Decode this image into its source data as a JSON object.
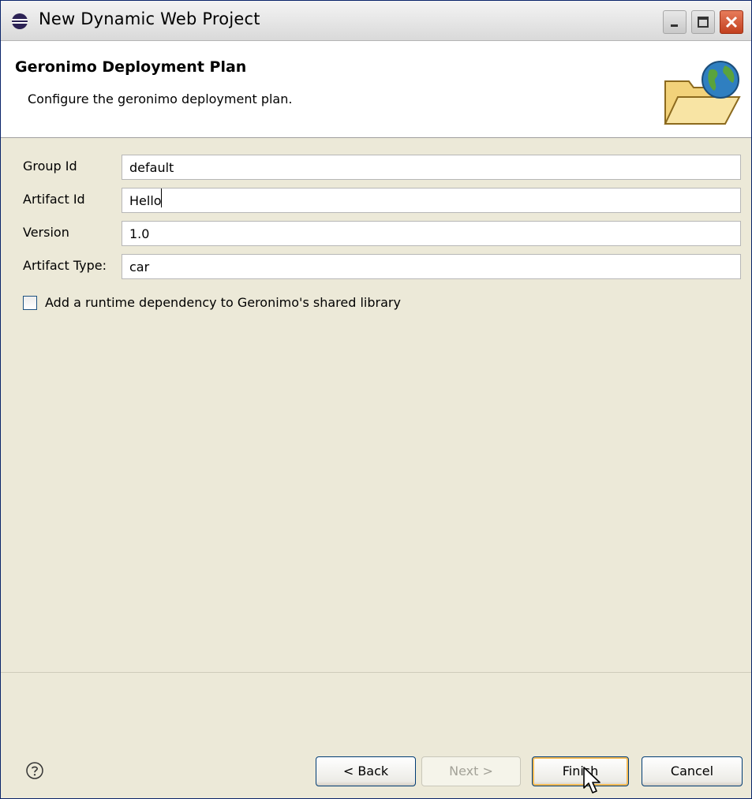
{
  "window": {
    "title": "New Dynamic Web Project",
    "icon": "eclipse-icon",
    "controls": [
      "minimize-icon",
      "maximize-icon",
      "close-icon"
    ]
  },
  "header": {
    "title": "Geronimo Deployment Plan",
    "description": "Configure the geronimo deployment plan.",
    "image": "folder-globe-icon"
  },
  "form": {
    "group_id": {
      "label": "Group Id",
      "value": "default"
    },
    "artifact_id": {
      "label": "Artifact Id",
      "value": "Hello"
    },
    "version": {
      "label": "Version",
      "value": "1.0"
    },
    "artifact_type": {
      "label": "Artifact Type:",
      "value": "car"
    },
    "shared_lib": {
      "label": "Add a runtime dependency to Geronimo's shared library",
      "checked": false
    }
  },
  "footer": {
    "help_icon": "help-icon",
    "back_label": "< Back",
    "next_label": "Next >",
    "finish_label": "Finish",
    "cancel_label": "Cancel"
  }
}
